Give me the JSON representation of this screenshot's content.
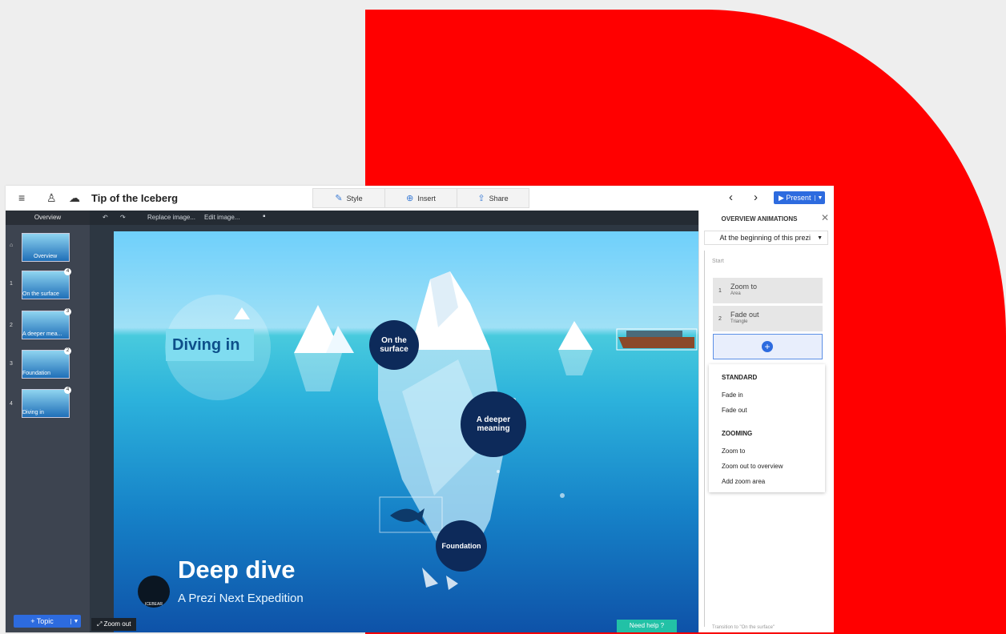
{
  "colors": {
    "accent": "#2d6bdf",
    "decor_red": "#ff0000",
    "help": "#22c1a6"
  },
  "header": {
    "menu_icon": "hamburger-icon",
    "user_icon": "user-icon",
    "cloud_icon": "cloud-icon",
    "title": "Tip of the Iceberg",
    "tabs": [
      {
        "label": "Style",
        "icon": "wand-icon"
      },
      {
        "label": "Insert",
        "icon": "plus-circle-icon"
      },
      {
        "label": "Share",
        "icon": "upload-icon"
      }
    ],
    "prev": "‹",
    "next": "›",
    "present": "Present"
  },
  "sidebar": {
    "header": "Overview",
    "overview_label": "Overview",
    "items": [
      {
        "num": "1",
        "label": "On the surface",
        "badge": "4"
      },
      {
        "num": "2",
        "label": "A deeper mea...",
        "badge": "3"
      },
      {
        "num": "3",
        "label": "Foundation",
        "badge": "2"
      },
      {
        "num": "4",
        "label": "Diving in",
        "badge": "4"
      }
    ],
    "add_topic": "+ Topic"
  },
  "canvas": {
    "toolbar": {
      "replace": "Replace image...",
      "edit": "Edit image..."
    },
    "zoom_out": "Zoom out",
    "need_help": "Need help",
    "slide": {
      "diving_in": "Diving in",
      "on_the_surface": "On the surface",
      "a_deeper_meaning": "A deeper meaning",
      "foundation": "Foundation",
      "title": "Deep dive",
      "subtitle": "A Prezi Next Expedition",
      "logo_text": "ICEBEAR"
    }
  },
  "panel": {
    "title": "OVERVIEW ANIMATIONS",
    "select": "At the beginning of this prezi",
    "start": "Start",
    "animations": [
      {
        "num": "1",
        "name": "Zoom to",
        "target": "Area"
      },
      {
        "num": "2",
        "name": "Fade out",
        "target": "Triangle"
      }
    ],
    "menu": {
      "standard": "STANDARD",
      "fade_in": "Fade in",
      "fade_out": "Fade out",
      "zooming": "ZOOMING",
      "zoom_to": "Zoom to",
      "zoom_overview": "Zoom out to overview",
      "add_zoom": "Add zoom area"
    },
    "transition": "Transition to \"On the surface\""
  }
}
